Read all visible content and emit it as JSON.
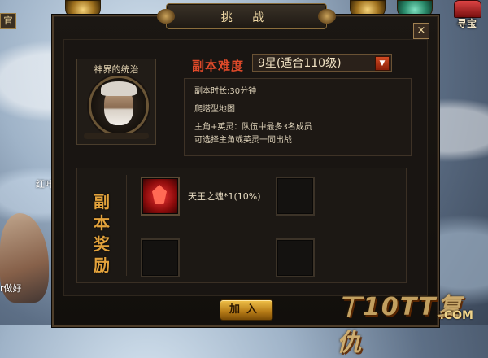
{
  "game": {
    "top_left_label": "官",
    "treasure_label": "寻宝",
    "bg_name_fragment": "红叶",
    "bg_chat_fragment": "r做好"
  },
  "dialog": {
    "title": "挑 战",
    "close_label": "×",
    "portrait_title": "神界的统治",
    "difficulty_label": "副本难度",
    "difficulty_value": "9星(适合110级)",
    "info_lines": [
      "副本时长:30分钟",
      "爬塔型地图",
      "主角+英灵：队伍中最多3名成员",
      "可选择主角或英灵一同出战"
    ],
    "reward_label_chars": [
      "副",
      "本",
      "奖",
      "励"
    ],
    "rewards": [
      {
        "name": "天王之魂*1(10%)",
        "filled": true
      },
      {
        "name": "",
        "filled": false
      },
      {
        "name": "",
        "filled": false
      },
      {
        "name": "",
        "filled": false
      }
    ],
    "join_label": "加入"
  },
  "watermark": {
    "main": "ㄒ10TT复仇",
    "suffix": ".COM"
  },
  "colors": {
    "accent_red": "#e04a2a",
    "gold": "#e2a23c",
    "text_light": "#ddd1b8"
  }
}
